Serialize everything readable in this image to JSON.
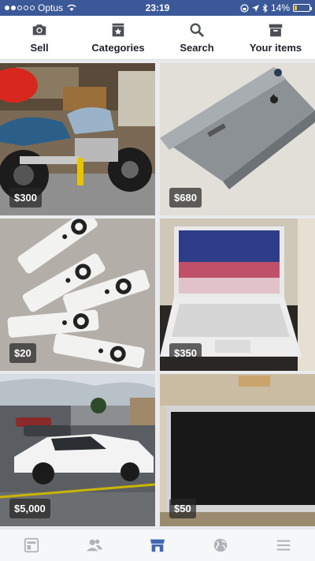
{
  "status": {
    "carrier": "Optus",
    "time": "23:19",
    "battery": "14%",
    "battery_level": 0.14
  },
  "actions": {
    "sell": "Sell",
    "categories": "Categories",
    "search": "Search",
    "your_items": "Your items"
  },
  "listings": [
    {
      "price": "$300"
    },
    {
      "price": "$680"
    },
    {
      "price": "$20"
    },
    {
      "price": "$350"
    },
    {
      "price": "$5,000"
    },
    {
      "price": "$50"
    }
  ],
  "tabs": [
    "feed-icon",
    "friends-icon",
    "marketplace-icon",
    "globe-icon",
    "menu-icon"
  ],
  "colors": {
    "brand": "#3b5998",
    "active_tab": "#4267b2",
    "inactive_tab": "#b0b3b8"
  }
}
